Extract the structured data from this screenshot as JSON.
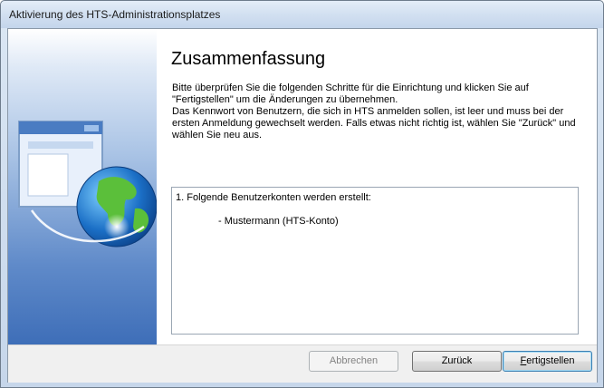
{
  "window": {
    "title": "Aktivierung des HTS-Administrationsplatzes"
  },
  "page": {
    "heading": "Zusammenfassung",
    "description_lines": [
      "Bitte überprüfen Sie die folgenden Schritte für die Einrichtung und klicken Sie auf",
      "\"Fertigstellen\" um die Änderungen zu übernehmen.",
      "Das Kennwort von Benutzern, die sich in HTS anmelden sollen, ist leer und muss bei der",
      "ersten Anmeldung gewechselt werden. Falls etwas nicht richtig ist, wählen Sie \"Zurück\" und",
      "wählen Sie neu aus."
    ]
  },
  "summary": {
    "header": "1. Folgende Benutzerkonten werden erstellt:",
    "items": [
      "- Mustermann (HTS-Konto)"
    ]
  },
  "buttons": {
    "cancel": "Abbrechen",
    "back": "Zurück",
    "finish_underlined": "F",
    "finish_rest": "ertigstellen"
  },
  "icons": {
    "sidebar_graphic": "window-globe-icon"
  }
}
